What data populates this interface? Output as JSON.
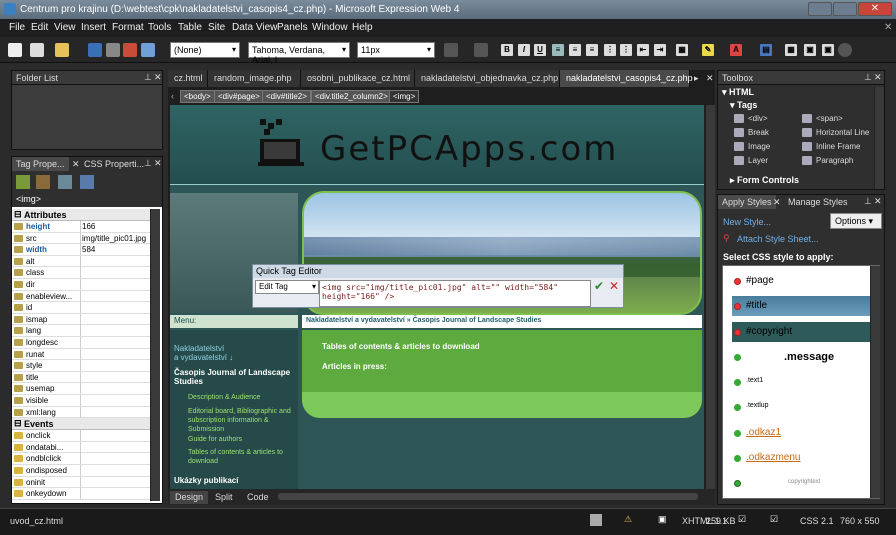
{
  "window": {
    "title": "Centrum pro krajinu (D:\\webtest\\cpk\\nakladatelstvi_casopis4_cz.php) - Microsoft Expression Web 4"
  },
  "menu": [
    "File",
    "Edit",
    "View",
    "Insert",
    "Format",
    "Tools",
    "Table",
    "Site",
    "Data View",
    "Panels",
    "Window",
    "Help"
  ],
  "toolbar": {
    "style_select": "(None)",
    "font_select": "Tahoma, Verdana, Arial, l",
    "size_select": "11px",
    "bold": "B",
    "italic": "I",
    "underline": "U"
  },
  "folder_list": {
    "title": "Folder List"
  },
  "tag_properties": {
    "tab1": "Tag Prope...",
    "tab2": "CSS Properti...",
    "current_tag": "<img>",
    "groups": {
      "attributes": "Attributes",
      "events": "Events"
    },
    "attributes": [
      {
        "name": "height",
        "value": "166"
      },
      {
        "name": "src",
        "value": "img/title_pic01.jpg"
      },
      {
        "name": "width",
        "value": "584"
      },
      {
        "name": "alt",
        "value": ""
      },
      {
        "name": "class",
        "value": ""
      },
      {
        "name": "dir",
        "value": ""
      },
      {
        "name": "enableview...",
        "value": ""
      },
      {
        "name": "id",
        "value": ""
      },
      {
        "name": "ismap",
        "value": ""
      },
      {
        "name": "lang",
        "value": ""
      },
      {
        "name": "longdesc",
        "value": ""
      },
      {
        "name": "runat",
        "value": ""
      },
      {
        "name": "style",
        "value": ""
      },
      {
        "name": "title",
        "value": ""
      },
      {
        "name": "usemap",
        "value": ""
      },
      {
        "name": "visible",
        "value": ""
      },
      {
        "name": "xml:lang",
        "value": ""
      }
    ],
    "events": [
      {
        "name": "onclick"
      },
      {
        "name": "ondatabi..."
      },
      {
        "name": "ondblclick"
      },
      {
        "name": "ondisposed"
      },
      {
        "name": "oninit"
      },
      {
        "name": "onkeydown"
      }
    ]
  },
  "editor": {
    "tabs": [
      "cz.html",
      "random_image.php",
      "osobni_publikace_cz.html",
      "nakladatelstvi_objednavka_cz.php",
      "nakladatelstvi_casopis4_cz.php"
    ],
    "breadcrumbs": [
      "<body>",
      "<div#page>",
      "<div#title2>",
      "<div.title2_column2>",
      "<img>"
    ],
    "site_logo": "GetPCApps.com",
    "menu_label": "Menu:",
    "page_breadcrumb": "Nakladatelství a vydavatelství » Časopis Journal of Landscape Studies",
    "sidebar_links": [
      "Nakladatelství",
      "a vydavatelství ↓"
    ],
    "sidebar_heading": "Časopis Journal of Landscape Studies",
    "sidebar_items": [
      "Description & Audience",
      "Editorial board, Bibliographic and subscription information & Submission",
      "Guide for authors",
      "Tables of contents & articles to download"
    ],
    "sidebar_heading2": "Ukázky publikací",
    "content_heading": "Tables of contents & articles to download",
    "content_sub": "Articles in press:",
    "view_tabs": [
      "Design",
      "Split",
      "Code"
    ]
  },
  "quick_tag_editor": {
    "title": "Quick Tag Editor",
    "mode": "Edit Tag",
    "code_line1": "<img src=\"img/title_pic01.jpg\" alt=\"\" width=\"584\"",
    "code_line2": "height=\"166\" />"
  },
  "toolbox": {
    "title": "Toolbox",
    "section": "HTML",
    "subsection": "Tags",
    "tags": [
      "<div>",
      "<span>",
      "Break",
      "Horizontal Line",
      "Image",
      "Inline Frame",
      "Layer",
      "Paragraph"
    ],
    "section2": "Form Controls"
  },
  "apply_styles": {
    "tab1": "Apply Styles",
    "tab2": "Manage Styles",
    "new_style": "New Style...",
    "options": "Options",
    "attach": "Attach Style Sheet...",
    "select_label": "Select CSS style to apply:",
    "styles": [
      "#page",
      "#title",
      "#copyright",
      ".message",
      ".text1",
      ".textlup",
      ".odkaz1",
      ".odkazmenu",
      "copyrightext"
    ]
  },
  "status": {
    "file": "uvod_cz.html",
    "doctype": "XHTML 1.1",
    "size": "259 KB",
    "css": "CSS 2.1",
    "dims": "760 x 550"
  }
}
